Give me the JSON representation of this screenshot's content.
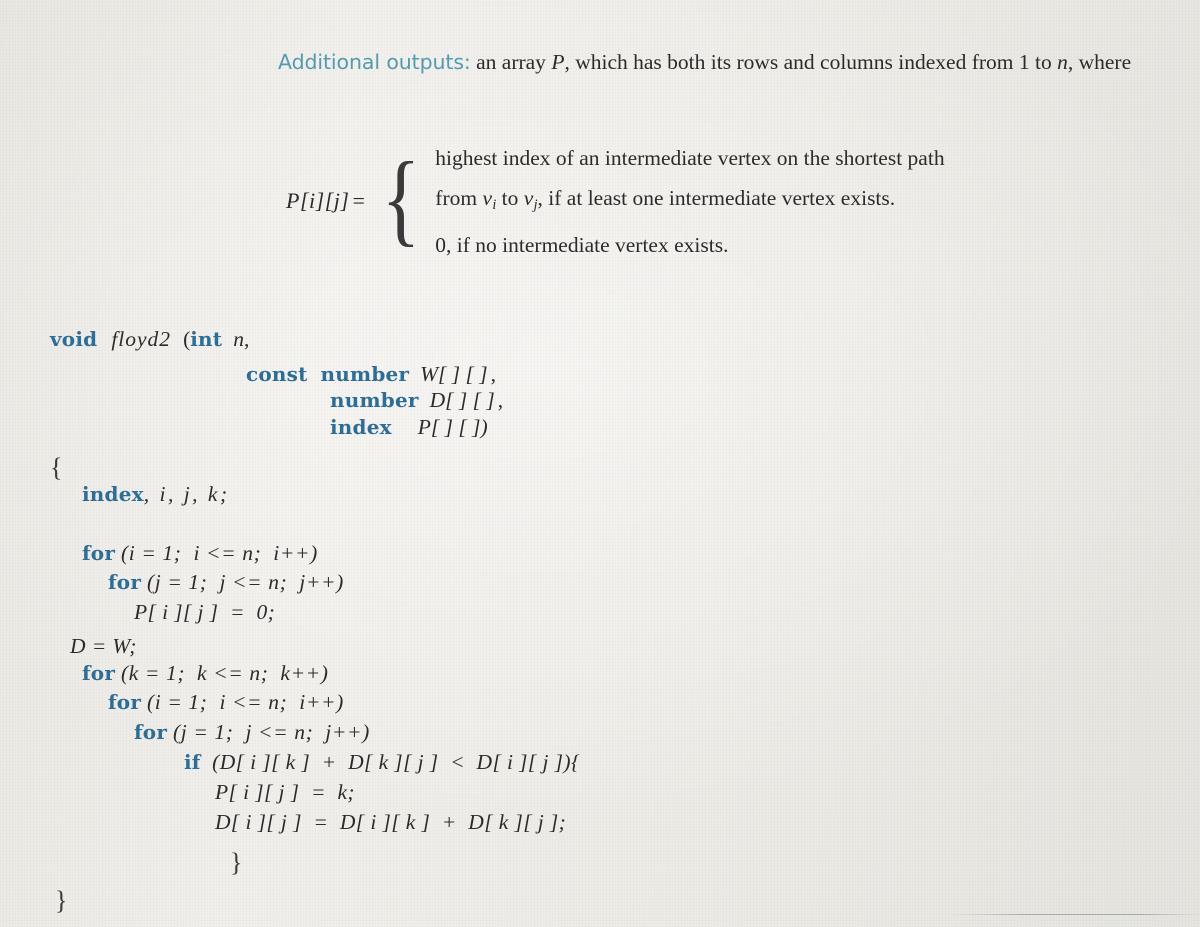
{
  "page": {
    "background_color": "#eeece7",
    "text_color": "#2b2b2b",
    "keyword_color": "#2e6d95",
    "label_color": "#539bb0"
  },
  "prose": {
    "label": "Additional outputs:",
    "text_part_1": " an array ",
    "var_P": "P",
    "text_part_2": ", which has both its rows and columns indexed from 1 to ",
    "var_n": "n",
    "text_part_3": ", where"
  },
  "piecewise": {
    "lhs_P": "P",
    "lhs_i": "[i]",
    "lhs_j": "[j]",
    "equals": "=",
    "brace": "{",
    "case_1_line_1": "highest index of an intermediate vertex on the shortest path",
    "case_1_line_2_a": "from ",
    "case_1_v_i": "v",
    "case_1_sub_i": "i",
    "case_1_line_2_b": " to ",
    "case_1_v_j": "v",
    "case_1_sub_j": "j",
    "case_1_line_2_c": ", if at least one intermediate vertex exists.",
    "case_2": "0, if no intermediate vertex exists."
  },
  "code": {
    "signature": {
      "kw_void": "void",
      "name": "floyd2",
      "paren_open": "(",
      "kw_int": "int",
      "param_n": "n",
      "comma_1": ",",
      "kw_const": "const",
      "kw_number_1": "number",
      "param_W": "W[ ] [ ]",
      "comma_2": ",",
      "kw_number_2": "number",
      "param_D": "D[ ] [ ]",
      "comma_3": ",",
      "kw_index": "index",
      "param_P": "P[ ] [ ])"
    },
    "body": {
      "open_brace": "{",
      "decl_kw": "index",
      "decl_vars": ", i, j, k;",
      "for_i_kw": "for",
      "for_i_rest": " (i = 1;  i <= n;  i++)",
      "for_j_kw": "for",
      "for_j_rest": " (j = 1;  j <= n;  j++)",
      "p_init": "P[ i ][ j ]  =  0;",
      "d_assign": "D = W;",
      "for_k_kw": "for",
      "for_k_rest": " (k = 1;  k <= n;  k++)",
      "for_i2_kw": "for",
      "for_i2_rest": " (i = 1;  i <= n;  i++)",
      "for_j2_kw": "for",
      "for_j2_rest": " (j = 1;  j <= n;  j++)",
      "if_kw": "if",
      "if_rest": "  (D[ i ][ k ]  +  D[ k ][ j ]  <  D[ i ][ j ]){",
      "p_set": "P[ i ][ j ]  =  k;",
      "d_set": "D[ i ][ j ]  =  D[ i ][ k ]  +  D[ k ][ j ];",
      "inner_close_brace": "}",
      "outer_close_brace": "}"
    }
  }
}
